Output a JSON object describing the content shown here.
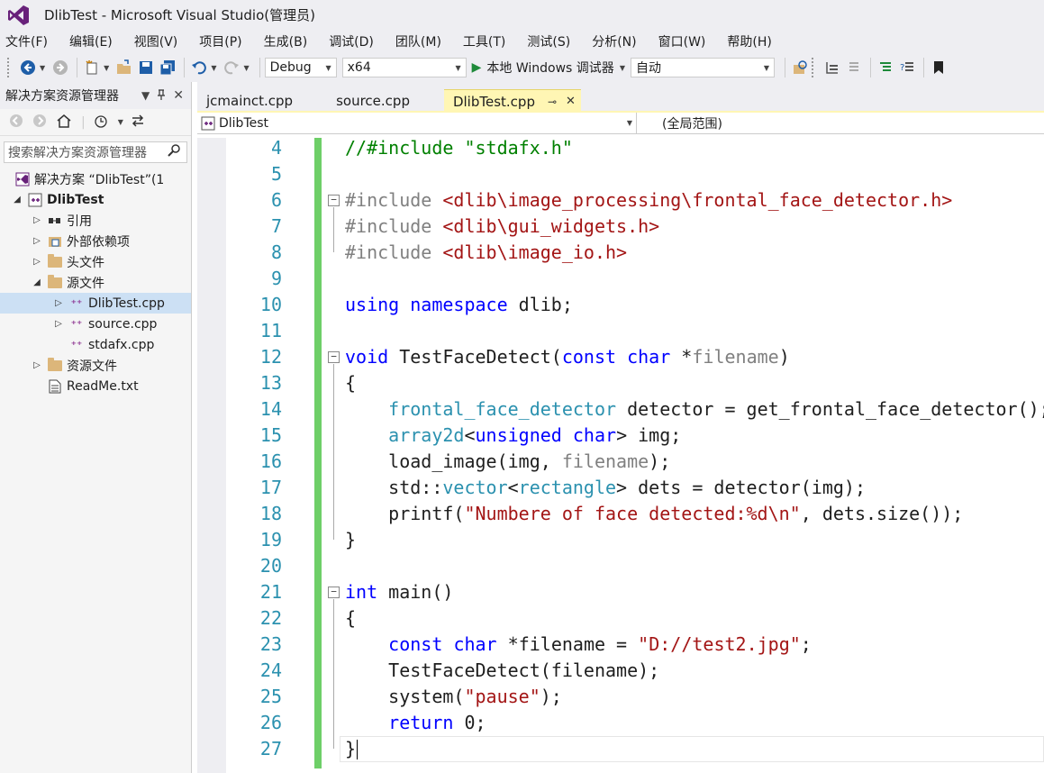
{
  "window": {
    "title": "DlibTest - Microsoft Visual Studio(管理员)"
  },
  "menu": [
    "文件(F)",
    "编辑(E)",
    "视图(V)",
    "项目(P)",
    "生成(B)",
    "调试(D)",
    "团队(M)",
    "工具(T)",
    "测试(S)",
    "分析(N)",
    "窗口(W)",
    "帮助(H)"
  ],
  "toolbar": {
    "config": "Debug",
    "platform": "x64",
    "run_label": "本地 Windows 调试器",
    "run_mode": "自动"
  },
  "solution_explorer": {
    "title": "解决方案资源管理器",
    "search_placeholder": "搜索解决方案资源管理器",
    "items": [
      {
        "label": "解决方案 “DlibTest”(1"
      },
      {
        "label": "DlibTest"
      },
      {
        "label": "引用"
      },
      {
        "label": "外部依赖项"
      },
      {
        "label": "头文件"
      },
      {
        "label": "源文件"
      },
      {
        "label": "DlibTest.cpp"
      },
      {
        "label": "source.cpp"
      },
      {
        "label": "stdafx.cpp"
      },
      {
        "label": "资源文件"
      },
      {
        "label": "ReadMe.txt"
      }
    ]
  },
  "editor": {
    "tabs": [
      "jcmainct.cpp",
      "source.cpp",
      "DlibTest.cpp"
    ],
    "nav_left": "DlibTest",
    "nav_right": "(全局范围)",
    "line_numbers": [
      "4",
      "5",
      "6",
      "7",
      "8",
      "9",
      "10",
      "11",
      "12",
      "13",
      "14",
      "15",
      "16",
      "17",
      "18",
      "19",
      "20",
      "21",
      "22",
      "23",
      "24",
      "25",
      "26",
      "27"
    ],
    "lines": [
      "//#include \"stdafx.h\"",
      "",
      "#include <dlib\\image_processing\\frontal_face_detector.h>",
      "#include <dlib\\gui_widgets.h>",
      "#include <dlib\\image_io.h>",
      "",
      "using namespace dlib;",
      "",
      "void TestFaceDetect(const char *filename)",
      "{",
      "    frontal_face_detector detector = get_frontal_face_detector();",
      "    array2d<unsigned char> img;",
      "    load_image(img, filename);",
      "    std::vector<rectangle> dets = detector(img);",
      "    printf(\"Numbere of face detected:%d\\n\", dets.size());",
      "}",
      "",
      "int main()",
      "{",
      "    const char *filename = \"D://test2.jpg\";",
      "    TestFaceDetect(filename);",
      "    system(\"pause\");",
      "    return 0;",
      "}"
    ]
  }
}
